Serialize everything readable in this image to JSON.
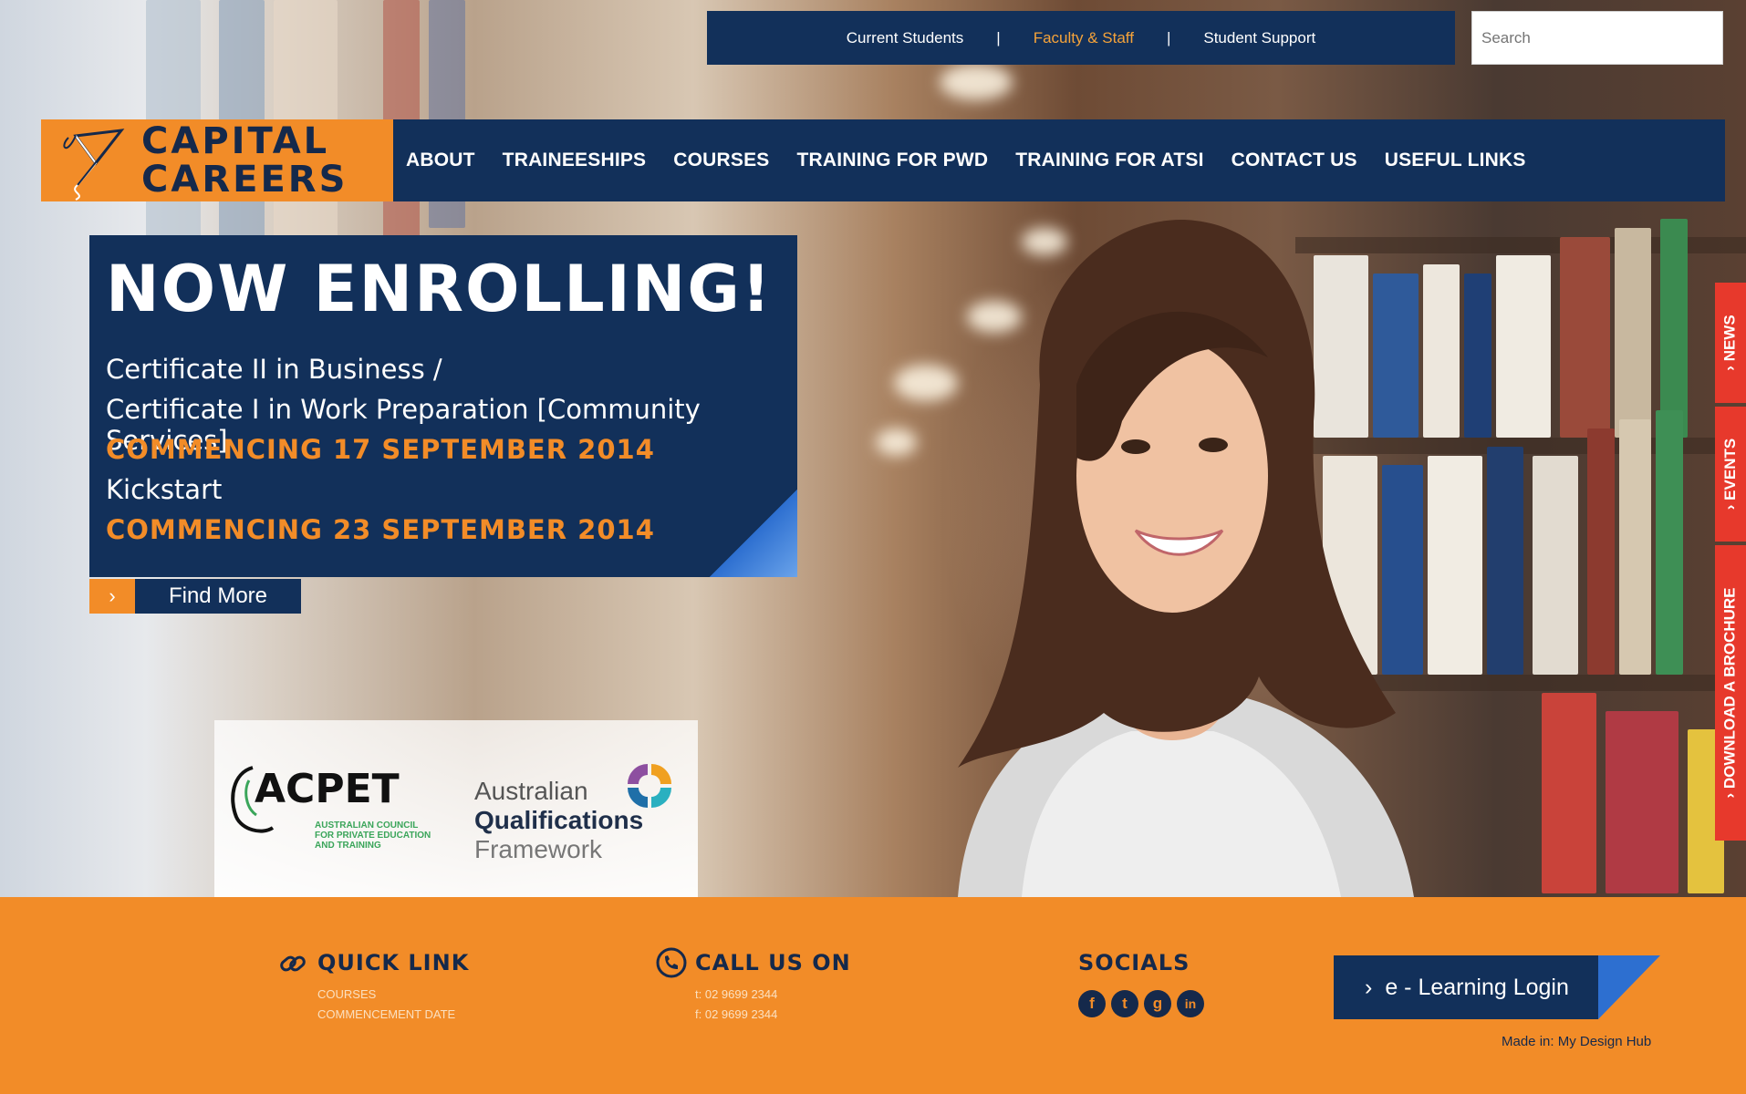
{
  "topbar": {
    "links": [
      "Current Students",
      "Faculty & Staff",
      "Student Support"
    ],
    "separator": "|"
  },
  "search": {
    "placeholder": "Search"
  },
  "logo": {
    "line1": "CAPITAL",
    "line2": "CAREERS"
  },
  "nav": {
    "items": [
      "ABOUT",
      "TRAINEESHIPS",
      "COURSES",
      "TRAINING FOR PWD",
      "TRAINING FOR ATSI",
      "CONTACT US",
      "USEFUL LINKS"
    ]
  },
  "hero": {
    "heading": "NOW ENROLLING!",
    "line1": "Certificate II in Business /",
    "line2": "Certificate I in Work Preparation [Community Services]",
    "date1": "COMMENCING 17 SEPTEMBER 2014",
    "line3": "Kickstart",
    "date2": "COMMENCING 23 SEPTEMBER 2014",
    "find_more": "Find More",
    "arrow": "›"
  },
  "partners": {
    "acpet_name": "ACPET",
    "acpet_sub": "AUSTRALIAN COUNCIL FOR PRIVATE EDUCATION AND TRAINING",
    "aqf_line1": "Australian",
    "aqf_line2": "Qualifications",
    "aqf_line3": "Framework"
  },
  "sidetabs": [
    "› NEWS",
    "› EVENTS",
    "› DOWNLOAD A BROCHURE"
  ],
  "footer": {
    "quick_link": {
      "heading": "QUICK LINK",
      "items": [
        "COURSES",
        "COMMENCEMENT DATE"
      ]
    },
    "call_us": {
      "heading": "CALL US ON",
      "items": [
        "t: 02 9699 2344",
        "f: 02 9699 2344"
      ]
    },
    "socials": {
      "heading": "SOCIALS",
      "icons": [
        "f",
        "t",
        "g",
        "in"
      ]
    },
    "elearning": "e - Learning Login",
    "elearning_arrow": "›",
    "made_in": "Made in: My Design Hub"
  },
  "colors": {
    "navy": "#12305a",
    "orange": "#f28c28",
    "red_tab": "#e7392c"
  }
}
